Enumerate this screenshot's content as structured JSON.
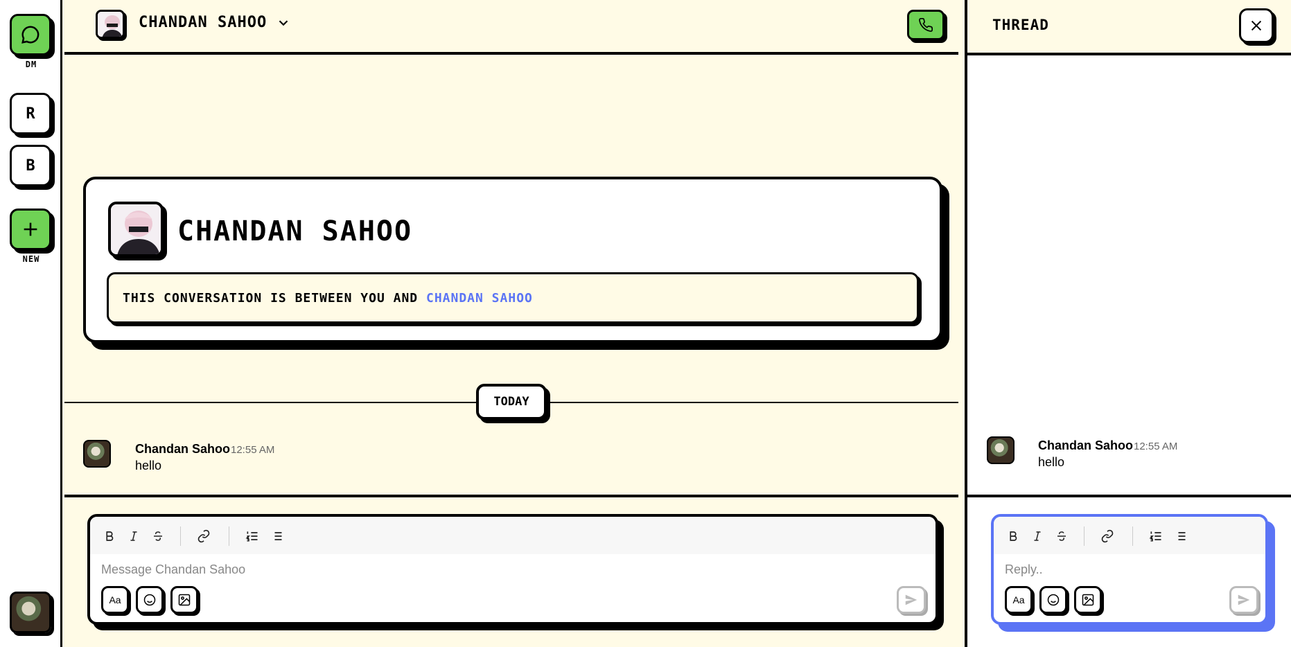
{
  "rail": {
    "dm_label": "DM",
    "workspaces": [
      {
        "letter": "R"
      },
      {
        "letter": "B"
      }
    ],
    "new_label": "NEW"
  },
  "header": {
    "contact_name": "CHANDAN SAHOO"
  },
  "intro": {
    "name": "CHANDAN SAHOO",
    "note_prefix": "THIS CONVERSATION IS BETWEEN YOU AND",
    "note_link": "CHANDAN SAHOO"
  },
  "divider": {
    "label": "TODAY"
  },
  "messages": [
    {
      "author": "Chandan Sahoo",
      "time": "12:55 AM",
      "text": "hello"
    }
  ],
  "composer": {
    "placeholder": "Message Chandan Sahoo",
    "format_label": "Aa"
  },
  "thread": {
    "title": "THREAD",
    "messages": [
      {
        "author": "Chandan Sahoo",
        "time": "12:55 AM",
        "text": "hello"
      }
    ],
    "reply_placeholder": "Reply..",
    "format_label": "Aa"
  },
  "colors": {
    "background": "#fffbe6",
    "accent_green": "#6fd255",
    "link_blue": "#5b74f5",
    "ink": "#000000"
  },
  "icons": {
    "dm": "chat-bubble-icon",
    "new": "plus-icon",
    "call": "phone-icon",
    "chevron": "chevron-down-icon",
    "close": "close-icon",
    "send": "send-icon"
  }
}
